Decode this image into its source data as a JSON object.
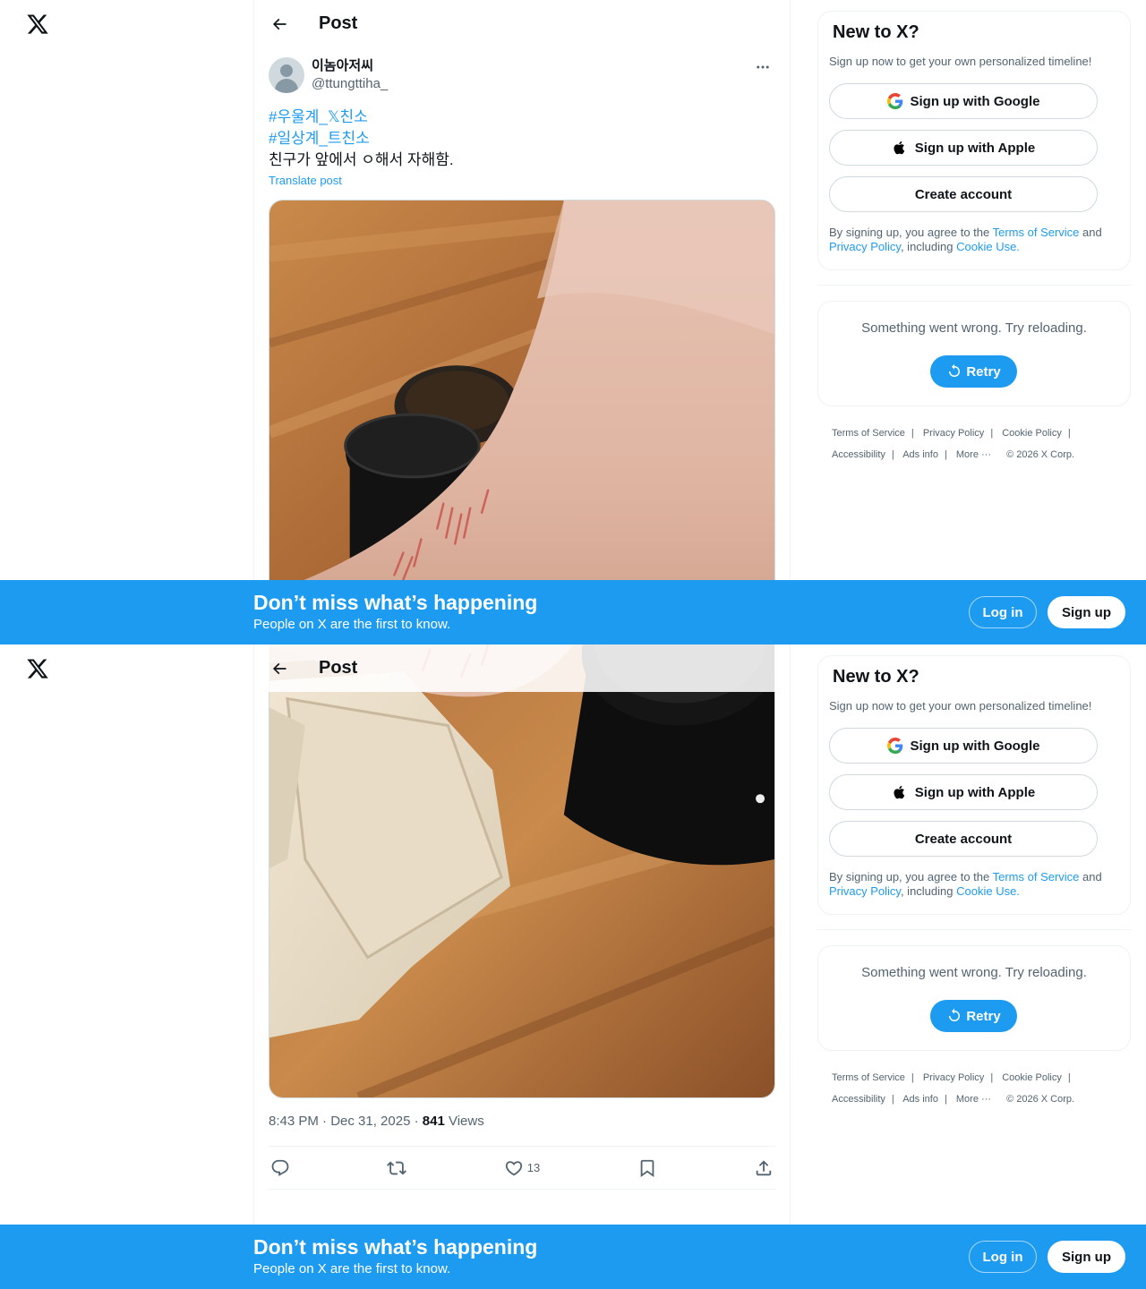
{
  "header": {
    "title": "Post"
  },
  "post": {
    "display_name": "이놈아저씨",
    "handle": "@ttungttiha_",
    "hashtag1": "#우울계_𝕏친소",
    "hashtag2": "#일상계_트친소",
    "text": "친구가 앞에서 ㅇ해서 자해함.",
    "translate": "Translate post",
    "time": "8:43 PM · Dec 31, 2025 · ",
    "views": "841",
    "views_label": " Views",
    "likes": "13"
  },
  "sidebar": {
    "title": "New to X?",
    "subtitle": "Sign up now to get your own personalized timeline!",
    "google": "Sign up with Google",
    "apple": "Sign up with Apple",
    "create": "Create account",
    "terms_prefix": "By signing up, you agree to the ",
    "terms_link": "Terms of Service",
    "terms_and": " and ",
    "privacy_link": "Privacy Policy",
    "including": ", including ",
    "cookie_link": "Cookie Use.",
    "error_text": "Something went wrong. Try reloading.",
    "retry": "Retry"
  },
  "footer": {
    "links": [
      "Terms of Service",
      "Privacy Policy",
      "Cookie Policy",
      "Accessibility",
      "Ads info",
      "More ···"
    ],
    "copyright": "© 2026 X Corp."
  },
  "banner": {
    "title": "Don’t miss what’s happening",
    "subtitle": "People on X are the first to know.",
    "login": "Log in",
    "signup": "Sign up"
  },
  "colors": {
    "accent": "#1d9bf0",
    "text": "#0f1419",
    "muted": "#536471"
  }
}
